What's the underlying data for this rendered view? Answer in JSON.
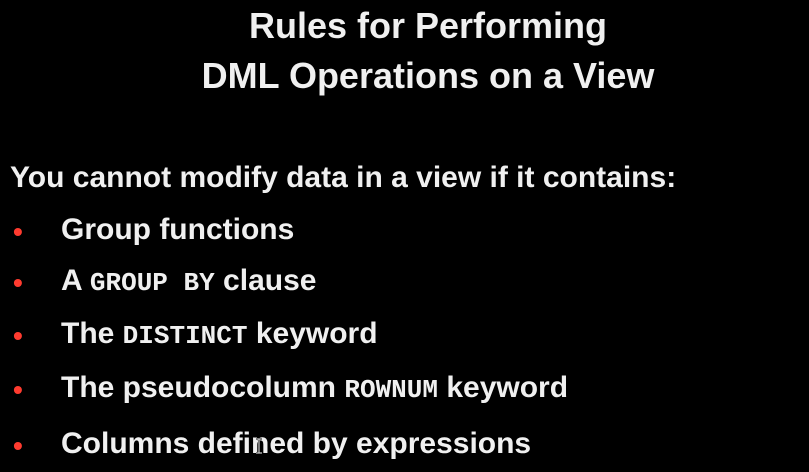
{
  "slide": {
    "title_line1": "Rules for Performing",
    "title_line2": "DML Operations on a View",
    "intro": "You cannot modify data in a view if it contains:",
    "bullet_symbol": "•",
    "bullet_color": "#ff3b2f",
    "bullets": [
      {
        "text": "Group functions"
      },
      {
        "before": "A ",
        "code": "GROUP BY",
        "after": " clause"
      },
      {
        "before": "The ",
        "code": "DISTINCT",
        "after": " keyword"
      },
      {
        "before": "The pseudocolumn ",
        "code": "ROWNUM",
        "after": " keyword"
      },
      {
        "text": "Columns defined by expressions"
      }
    ]
  }
}
